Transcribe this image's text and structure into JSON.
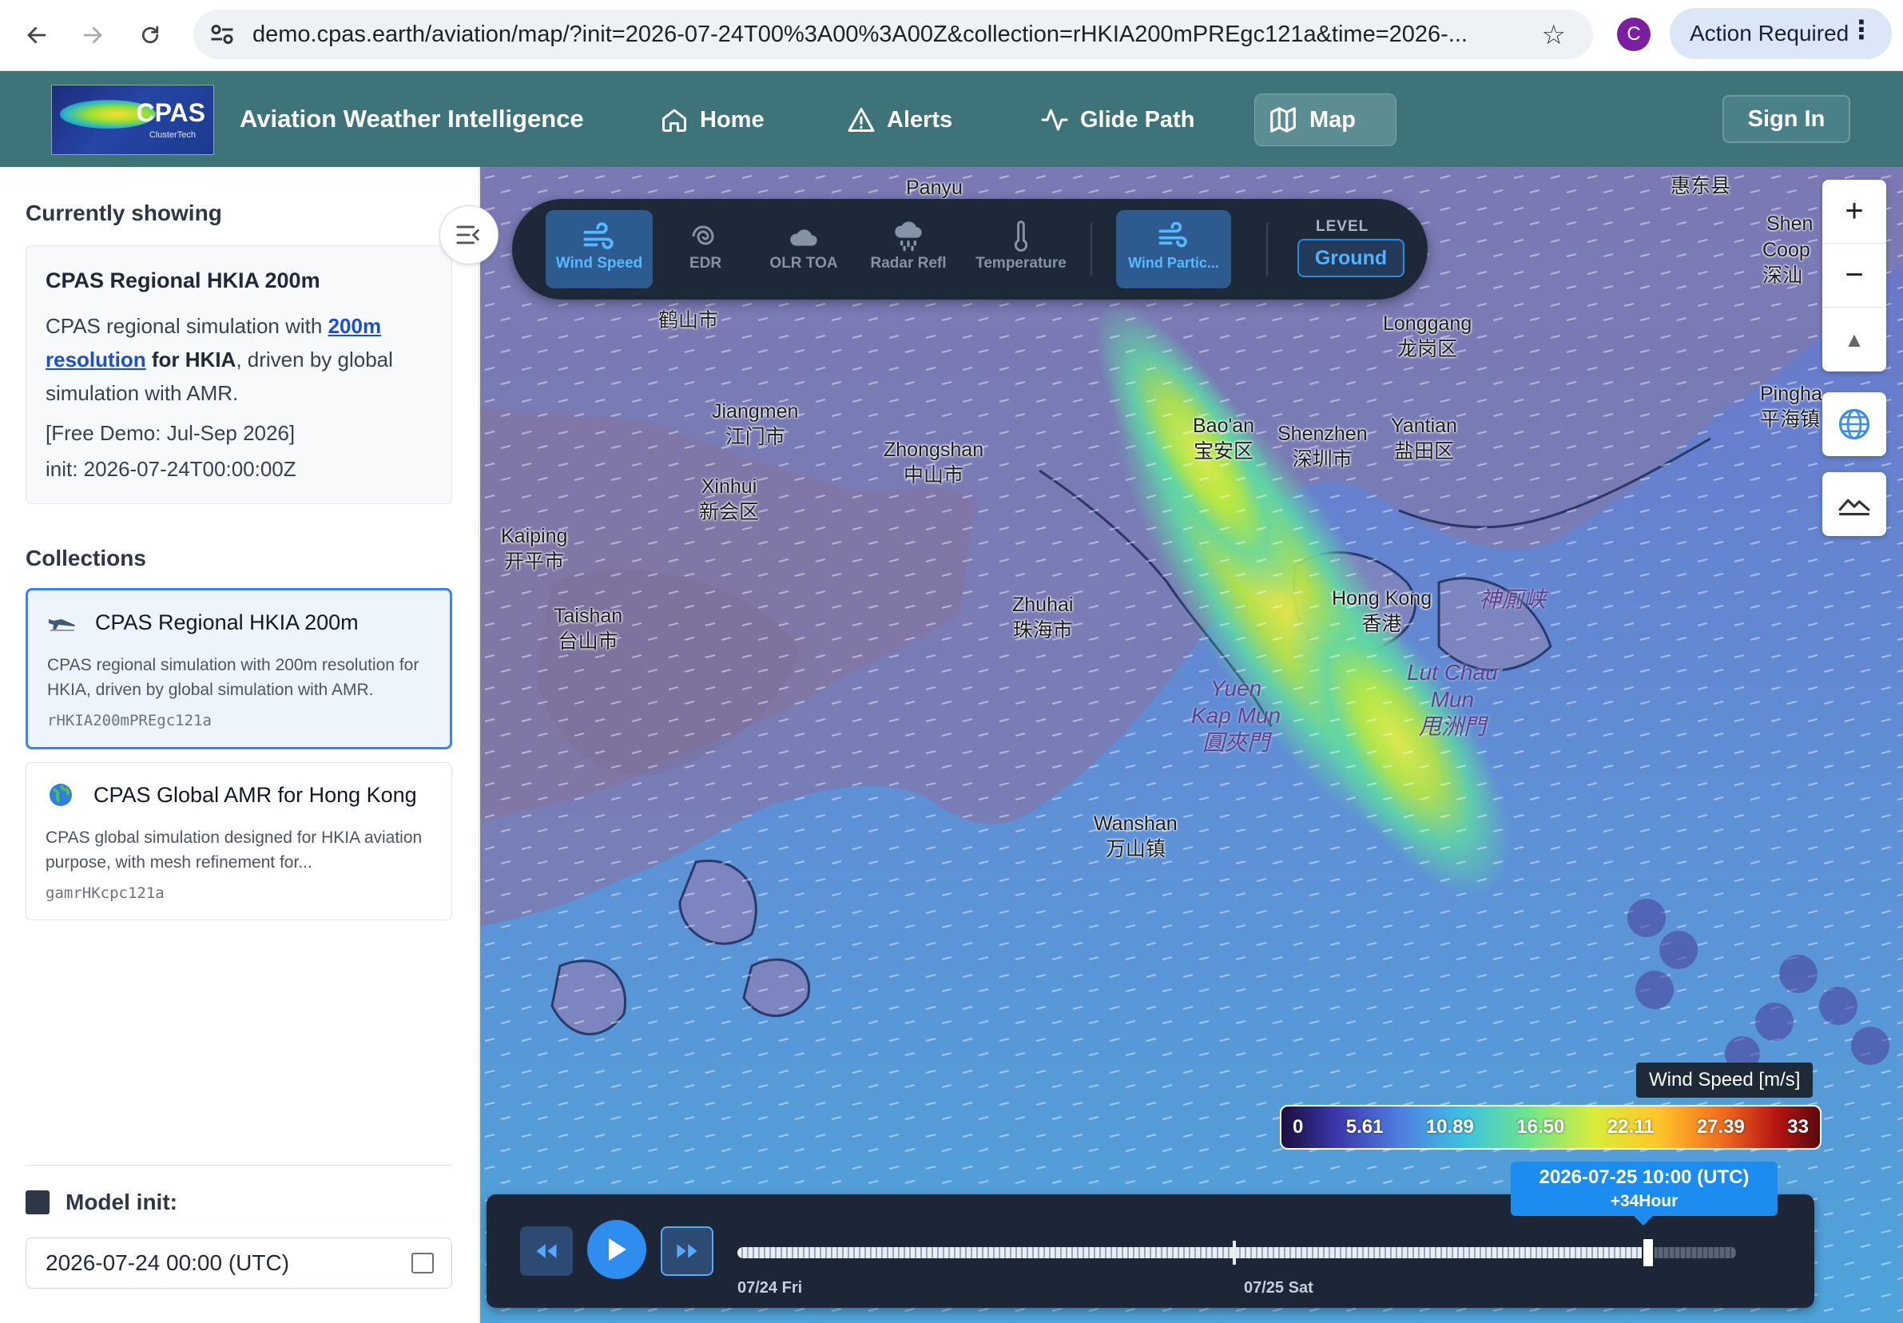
{
  "browser": {
    "url": "demo.cpas.earth/aviation/map/?init=2026-07-24T00%3A00%3A00Z&collection=rHKIA200mPREgc121a&time=2026-...",
    "profile_initial": "C",
    "action_required": "Action Required"
  },
  "header": {
    "logo_text": "CPAS",
    "logo_sub": "ClusterTech",
    "title": "Aviation Weather Intelligence",
    "nav": [
      {
        "label": "Home",
        "icon": "home-icon"
      },
      {
        "label": "Alerts",
        "icon": "alert-triangle-icon"
      },
      {
        "label": "Glide Path",
        "icon": "activity-icon"
      },
      {
        "label": "Map",
        "icon": "map-icon",
        "active": true
      }
    ],
    "sign_in": "Sign In"
  },
  "sidebar": {
    "currently_showing_heading": "Currently showing",
    "current": {
      "title": "CPAS Regional HKIA 200m",
      "desc_pre": "CPAS regional simulation with ",
      "desc_link": "200m resolution",
      "desc_bold": " for HKIA",
      "desc_post": ", driven by global simulation with AMR.",
      "free_demo": "[Free Demo: Jul-Sep 2026]",
      "init": "init: 2026-07-24T00:00:00Z"
    },
    "collections_heading": "Collections",
    "collections": [
      {
        "title": "CPAS Regional HKIA 200m",
        "icon": "airplane-icon",
        "desc": "CPAS regional simulation with 200m resolution for HKIA, driven by global simulation with AMR.",
        "code": "rHKIA200mPREgc121a",
        "selected": true
      },
      {
        "title": "CPAS Global AMR for Hong Kong",
        "icon": "globe-icon",
        "desc": "CPAS global simulation designed for HKIA aviation purpose, with mesh refinement for...",
        "code": "gamrHKcpc121a",
        "selected": false
      }
    ],
    "model_init_label": "Model init:",
    "model_init_value": "2026-07-24 00:00 (UTC)"
  },
  "layers": {
    "items": [
      {
        "label": "Wind Speed",
        "icon": "wind-icon",
        "active": true
      },
      {
        "label": "EDR",
        "icon": "spiral-icon",
        "active": false
      },
      {
        "label": "OLR TOA",
        "icon": "cloud-icon",
        "active": false
      },
      {
        "label": "Radar Refl",
        "icon": "rain-cloud-icon",
        "active": false
      },
      {
        "label": "Temperature",
        "icon": "thermometer-icon",
        "active": false
      }
    ],
    "particles": {
      "label": "Wind Partic...",
      "icon": "wind-particles-icon",
      "active": true
    },
    "level_label": "LEVEL",
    "level_value": "Ground"
  },
  "map": {
    "places": [
      {
        "en": "Panyu",
        "zh": ""
      },
      {
        "en": "",
        "zh": "惠东县"
      },
      {
        "en": "",
        "zh": "鹤山市"
      },
      {
        "en": "Longgang",
        "zh": "龙岗区"
      },
      {
        "en": "Shen",
        "zh": ""
      },
      {
        "en": "Coop",
        "zh": "深汕"
      },
      {
        "en": "Pingha",
        "zh": "平海镇"
      },
      {
        "en": "Jiangmen",
        "zh": "江门市"
      },
      {
        "en": "Zhongshan",
        "zh": "中山市"
      },
      {
        "en": "Bao'an",
        "zh": "宝安区"
      },
      {
        "en": "Shenzhen",
        "zh": "深圳市"
      },
      {
        "en": "Yantian",
        "zh": "盐田区"
      },
      {
        "en": "Xinhui",
        "zh": "新会区"
      },
      {
        "en": "Kaiping",
        "zh": "开平市"
      },
      {
        "en": "Taishan",
        "zh": "台山市"
      },
      {
        "en": "Zhuhai",
        "zh": "珠海市"
      },
      {
        "en": "Hong Kong",
        "zh": "香港"
      },
      {
        "en": "Wanshan",
        "zh": "万山镇"
      }
    ],
    "sea_labels": [
      {
        "text": "神厠峡"
      },
      {
        "text": "Yuen\nKap Mun\n圓夾門"
      },
      {
        "text": "Lut Chau\nMun\n甩洲門"
      }
    ],
    "controls": {
      "zoom_in": "+",
      "zoom_out": "−",
      "compass": "▲"
    }
  },
  "legend": {
    "title": "Wind Speed [m/s]",
    "ticks": [
      "0",
      "5.61",
      "10.89",
      "16.50",
      "22.11",
      "27.39",
      "33"
    ]
  },
  "timeline": {
    "tooltip_time": "2026-07-25 10:00 (UTC)",
    "tooltip_offset": "+34Hour",
    "day_labels": [
      "07/24 Fri",
      "07/25 Sat"
    ],
    "progress": 0.91
  },
  "colors": {
    "header_bg": "#3e7379",
    "accent": "#3b82f6",
    "layer_bar_bg": "#1d2838",
    "active_layer": "#56b8ff"
  }
}
